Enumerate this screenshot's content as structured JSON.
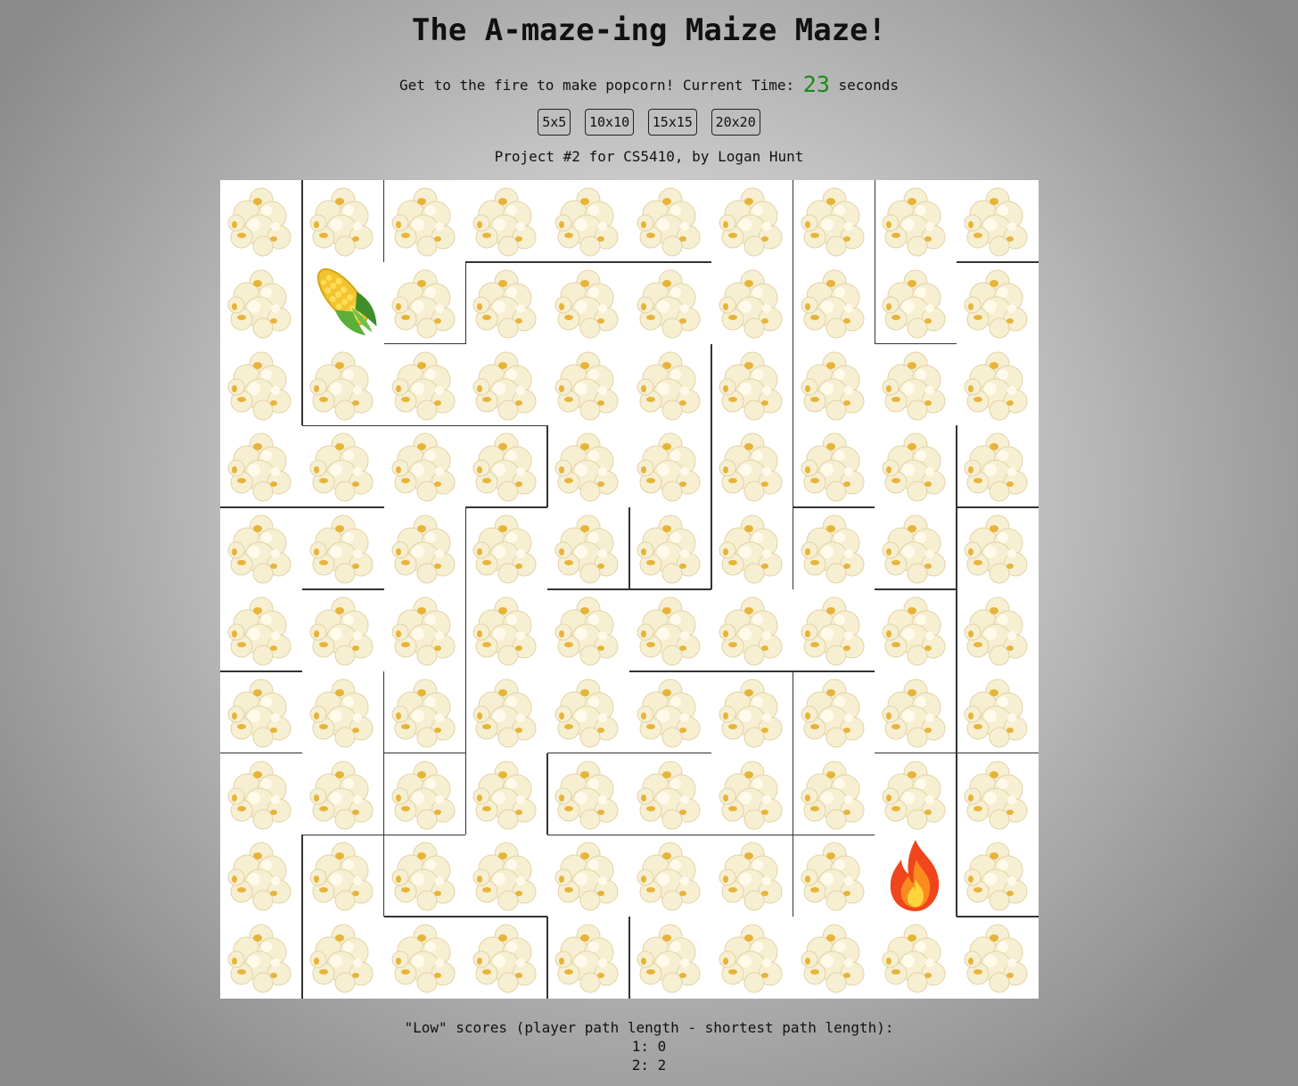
{
  "header": {
    "title": "The A-maze-ing Maize Maze!",
    "instructions": "Get to the fire to make popcorn! Current Time:",
    "time_value": "23",
    "time_unit": "seconds",
    "time_color": "#1a8a1a"
  },
  "size_buttons": [
    "5x5",
    "10x10",
    "15x15",
    "20x20"
  ],
  "credit": "Project #2 for CS5410, by Logan Hunt",
  "maze": {
    "rows": 10,
    "cols": 10,
    "tile_icon": "popcorn-icon",
    "player": {
      "row": 1,
      "col": 1,
      "icon": "corn-icon"
    },
    "goal": {
      "row": 8,
      "col": 8,
      "icon": "fire-icon"
    },
    "wall_color": "#333333"
  },
  "scores": {
    "heading": "\"Low\" scores (player path length - shortest path length):",
    "entries": [
      "1: 0",
      "2: 2"
    ]
  }
}
